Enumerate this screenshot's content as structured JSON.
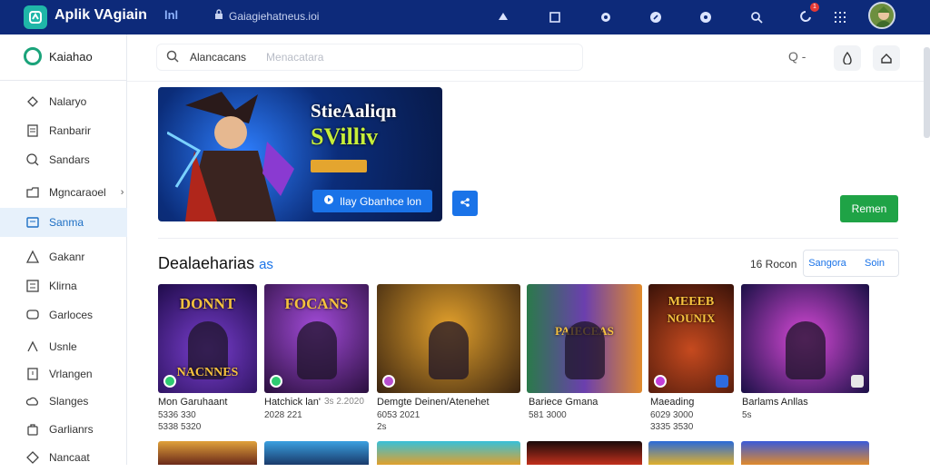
{
  "topbar": {
    "app_title": "Aplik VAgiain",
    "mid_badge": "lnl",
    "url_text": "Gaiagiehatneus.ioi",
    "notif_count": "1"
  },
  "sidebar": {
    "brand": "Kaiahao",
    "items": [
      {
        "label": "Nalaryo",
        "icon": "puzzle-icon"
      },
      {
        "label": "Ranbarir",
        "icon": "document-icon"
      },
      {
        "label": "Sandars",
        "icon": "search-icon"
      },
      {
        "label": "Mgncaraoel",
        "icon": "folder-icon",
        "chevron": "›"
      },
      {
        "label": "Sanma",
        "icon": "screen-icon",
        "active": true
      },
      {
        "label": "Gakanr",
        "icon": "triangle-icon"
      },
      {
        "label": "Klirna",
        "icon": "grid-icon"
      },
      {
        "label": "Garloces",
        "icon": "chat-icon"
      },
      {
        "label": "Usnle",
        "icon": "shape-icon"
      },
      {
        "label": "Vrlangen",
        "icon": "note-icon"
      },
      {
        "label": "Slanges",
        "icon": "cloud-icon"
      },
      {
        "label": "Garlianrs",
        "icon": "bag-icon"
      },
      {
        "label": "Nancaat",
        "icon": "diamond-icon"
      }
    ]
  },
  "search": {
    "value": "Alancacans",
    "placeholder": "Menacatara",
    "right_text": "Q -"
  },
  "hero": {
    "title_line1": "StieAaliqn",
    "title_line2": "SVilliv",
    "cta_label": "Ilay Gbanhce lon",
    "side_button_icon": "share-icon"
  },
  "green_button": "Remen",
  "section": {
    "title": "Dealaeharias",
    "title_accent": "as",
    "count": "16 Rocon",
    "seg_left": "Sangora",
    "seg_right": "Soin"
  },
  "cards": [
    {
      "name": "Mon Garuhaant",
      "meta1": "5336 330",
      "meta2": "5338 5320",
      "cover_top": "DONNT",
      "cover_bottom": "NACNNES"
    },
    {
      "name": "Hatchick lan'",
      "meta1": "2028 221",
      "meta2": "",
      "extra": "3s 2.2020",
      "cover_top": "FOCANS",
      "cover_bottom": ""
    },
    {
      "name": "Demgte Deinen/Atenehet",
      "meta1": "6053 2021",
      "meta2": "2s",
      "cover_top": "",
      "cover_bottom": ""
    },
    {
      "name": "Bariece Gmana",
      "meta1": "581 3000",
      "meta2": "",
      "cover_top": "PAIECEAS",
      "cover_bottom": ""
    },
    {
      "name": "Maeading",
      "meta1": "6029 3000",
      "meta2": "3335 3530",
      "cover_top": "MEEEB",
      "cover_bottom": "NOUNIX"
    },
    {
      "name": "Barlams Anllas",
      "meta1": "5s",
      "meta2": "",
      "cover_top": "",
      "cover_bottom": ""
    }
  ],
  "colors": {
    "topbar": "#0d2a7a",
    "accent": "#1a73e8",
    "green": "#1fa346",
    "active_bg": "#e7f1fb"
  }
}
